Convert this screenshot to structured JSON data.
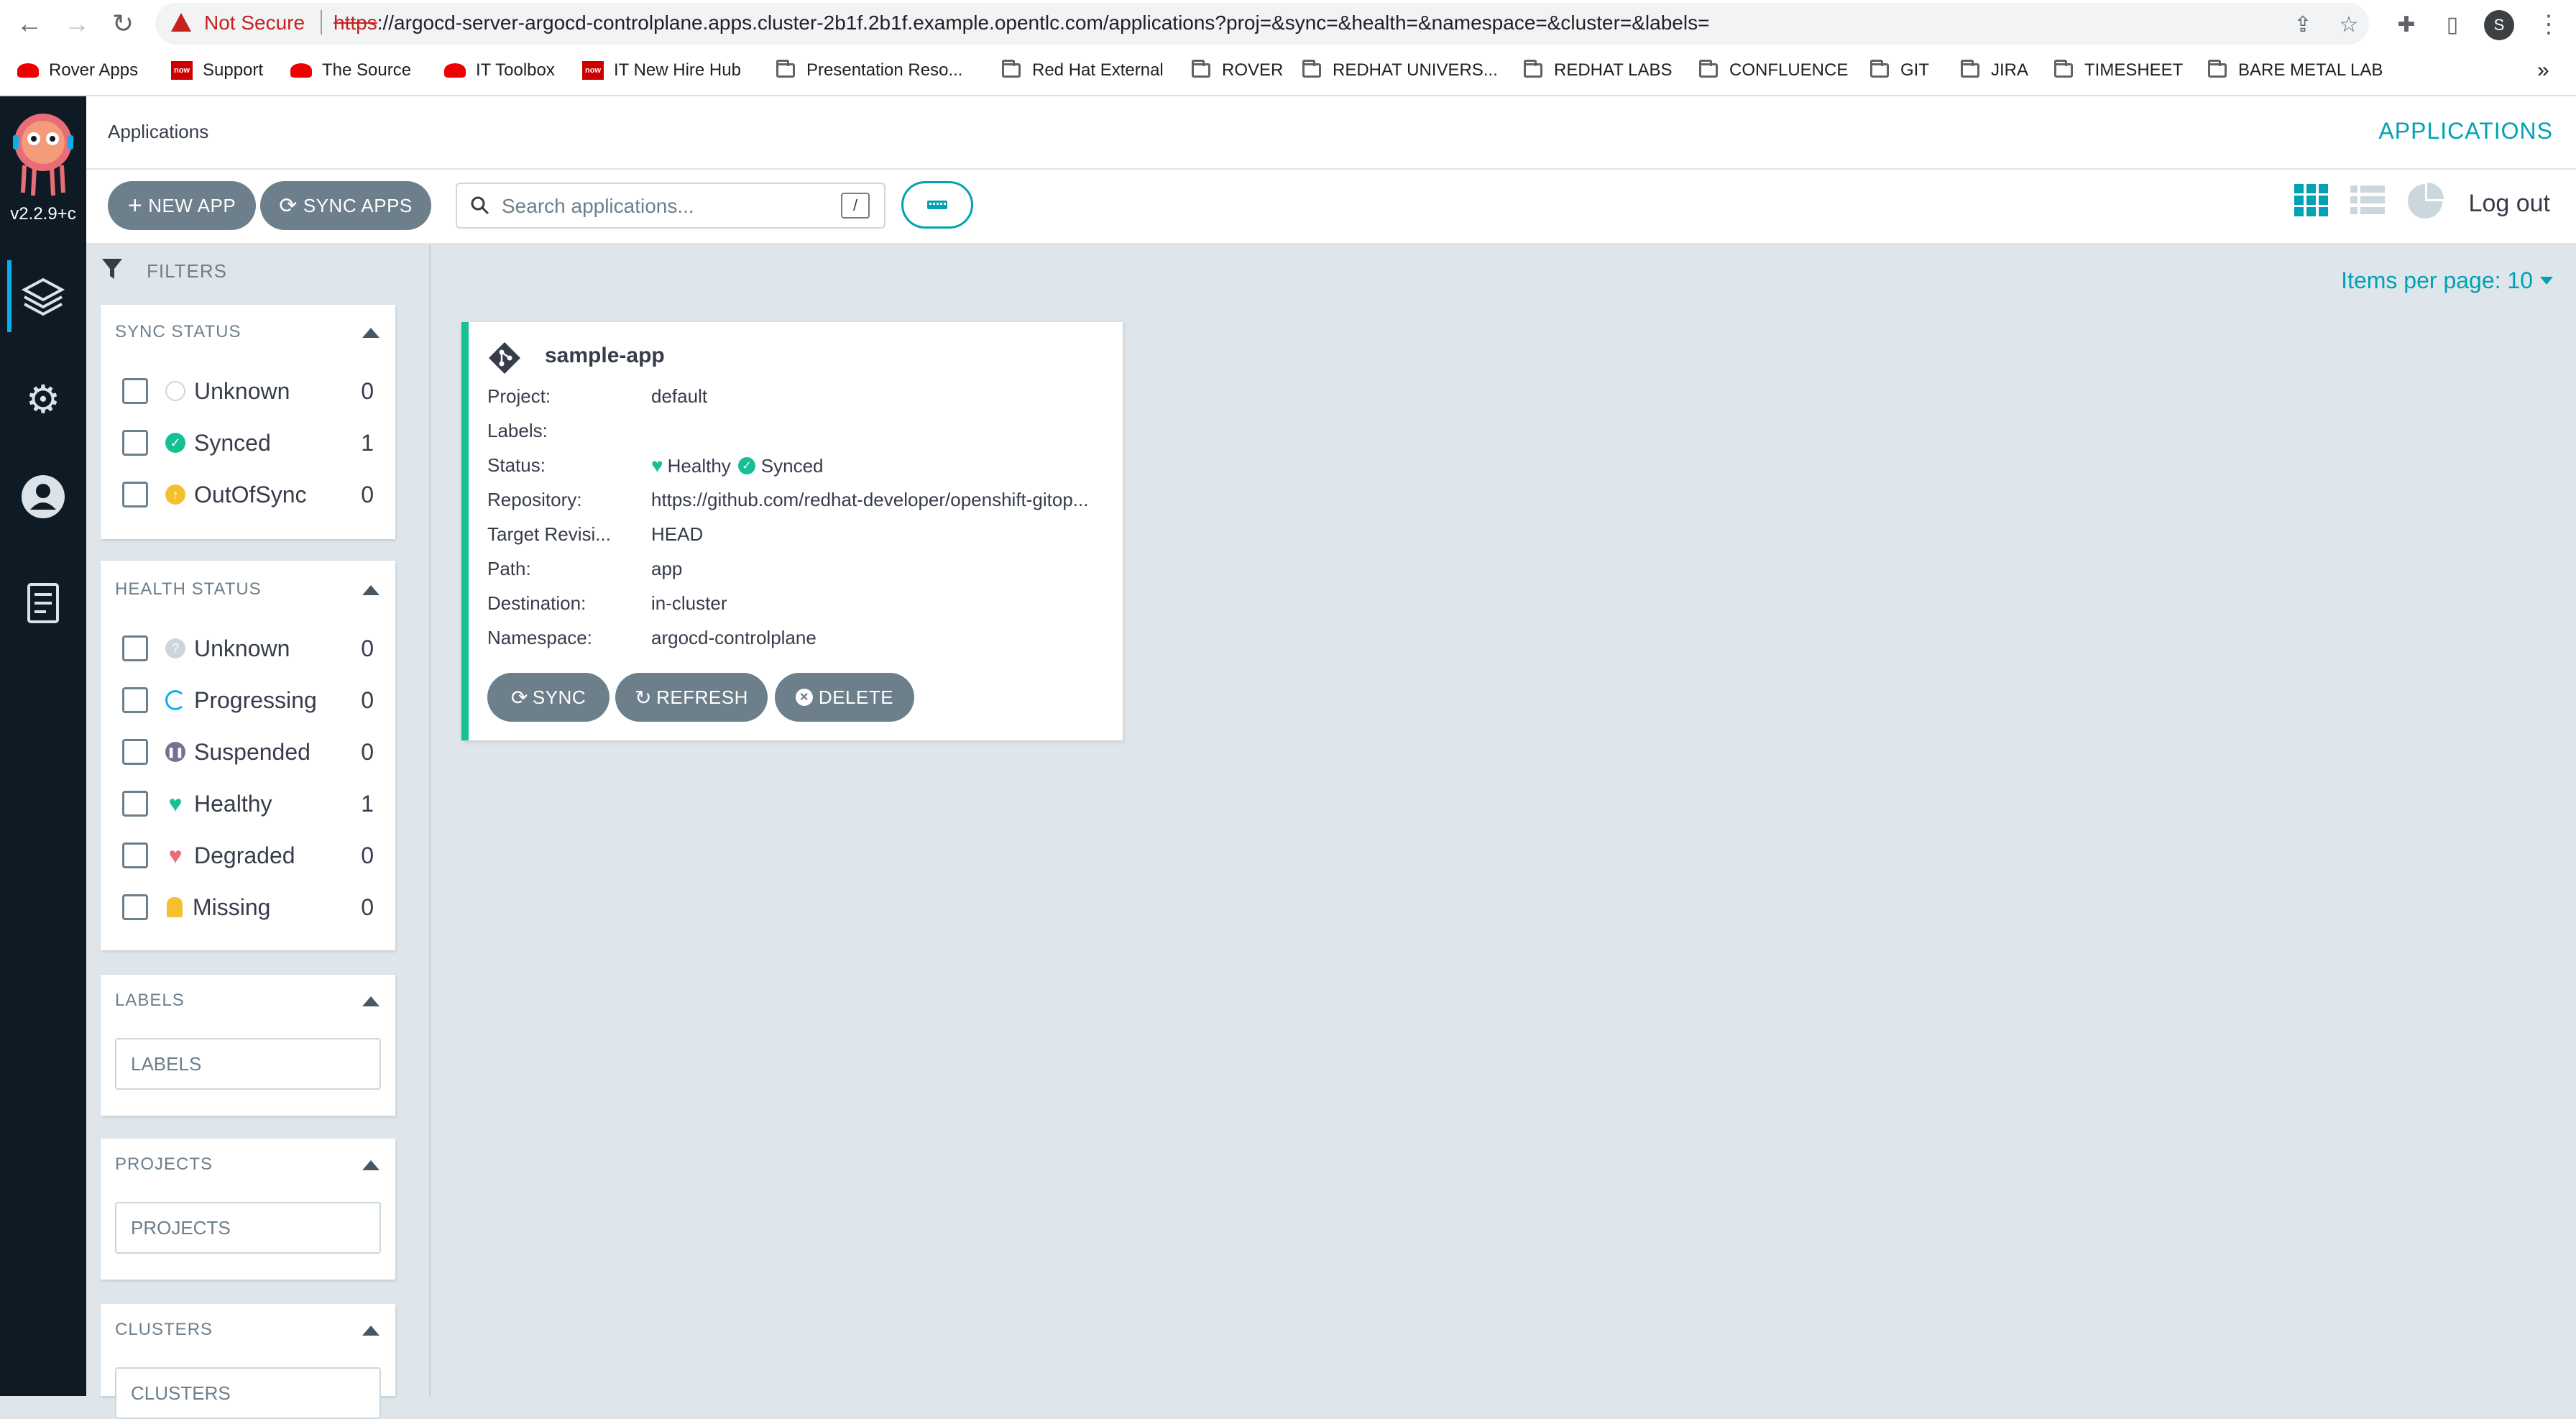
{
  "browser": {
    "security_label": "Not Secure",
    "url_scheme": "https",
    "url_rest": "://argocd-server-argocd-controlplane.apps.cluster-2b1f.2b1f.example.opentlc.com/applications?proj=&sync=&health=&namespace=&cluster=&labels=",
    "profile_initial": "S"
  },
  "bookmarks": [
    {
      "label": "Rover Apps",
      "icon": "redhat-icon"
    },
    {
      "label": "Support",
      "icon": "servicenow-icon"
    },
    {
      "label": "The Source",
      "icon": "redhat-icon"
    },
    {
      "label": "IT Toolbox",
      "icon": "redhat-icon"
    },
    {
      "label": "IT New Hire Hub",
      "icon": "servicenow-icon"
    },
    {
      "label": "Presentation Reso...",
      "icon": "folder-icon"
    },
    {
      "label": "Red Hat External",
      "icon": "folder-icon"
    },
    {
      "label": "ROVER",
      "icon": "folder-icon"
    },
    {
      "label": "REDHAT UNIVERS...",
      "icon": "folder-icon"
    },
    {
      "label": "REDHAT LABS",
      "icon": "folder-icon"
    },
    {
      "label": "CONFLUENCE",
      "icon": "folder-icon"
    },
    {
      "label": "GIT",
      "icon": "folder-icon"
    },
    {
      "label": "JIRA",
      "icon": "folder-icon"
    },
    {
      "label": "TIMESHEET",
      "icon": "folder-icon"
    },
    {
      "label": "BARE METAL LAB",
      "icon": "folder-icon"
    }
  ],
  "servicenow_badge": "now",
  "more_bookmarks": "»",
  "sidebar": {
    "version": "v2.2.9+c"
  },
  "header": {
    "title": "Applications",
    "link": "APPLICATIONS"
  },
  "toolbar": {
    "new_app": "NEW APP",
    "sync_apps": "SYNC APPS",
    "search_placeholder": "Search applications...",
    "search_shortcut": "/",
    "logout": "Log out"
  },
  "filters": {
    "title": "FILTERS",
    "sync_status": {
      "heading": "SYNC STATUS",
      "items": [
        {
          "label": "Unknown",
          "count": "0"
        },
        {
          "label": "Synced",
          "count": "1"
        },
        {
          "label": "OutOfSync",
          "count": "0"
        }
      ]
    },
    "health_status": {
      "heading": "HEALTH STATUS",
      "items": [
        {
          "label": "Unknown",
          "count": "0"
        },
        {
          "label": "Progressing",
          "count": "0"
        },
        {
          "label": "Suspended",
          "count": "0"
        },
        {
          "label": "Healthy",
          "count": "1"
        },
        {
          "label": "Degraded",
          "count": "0"
        },
        {
          "label": "Missing",
          "count": "0"
        }
      ]
    },
    "labels": {
      "heading": "LABELS",
      "placeholder": "LABELS"
    },
    "projects": {
      "heading": "PROJECTS",
      "placeholder": "PROJECTS"
    },
    "clusters": {
      "heading": "CLUSTERS",
      "placeholder": "CLUSTERS"
    }
  },
  "main": {
    "items_per_page": "Items per page: 10"
  },
  "app": {
    "name": "sample-app",
    "fields": [
      {
        "label": "Project:",
        "value": "default"
      },
      {
        "label": "Labels:",
        "value": ""
      },
      {
        "label": "Status:",
        "value": ""
      },
      {
        "label": "Repository:",
        "value": "https://github.com/redhat-developer/openshift-gitop..."
      },
      {
        "label": "Target Revisi...",
        "value": "HEAD"
      },
      {
        "label": "Path:",
        "value": "app"
      },
      {
        "label": "Destination:",
        "value": "in-cluster"
      },
      {
        "label": "Namespace:",
        "value": "argocd-controlplane"
      }
    ],
    "health": "Healthy",
    "sync": "Synced",
    "actions": {
      "sync": "SYNC",
      "refresh": "REFRESH",
      "delete": "DELETE"
    }
  },
  "colors": {
    "accent": "#00a2b3",
    "healthy": "#18be94",
    "out_of_sync": "#f4c030",
    "progressing": "#0dadea",
    "degraded": "#e96d76",
    "button": "#6d7f8b",
    "nav": "#0e1a24"
  }
}
